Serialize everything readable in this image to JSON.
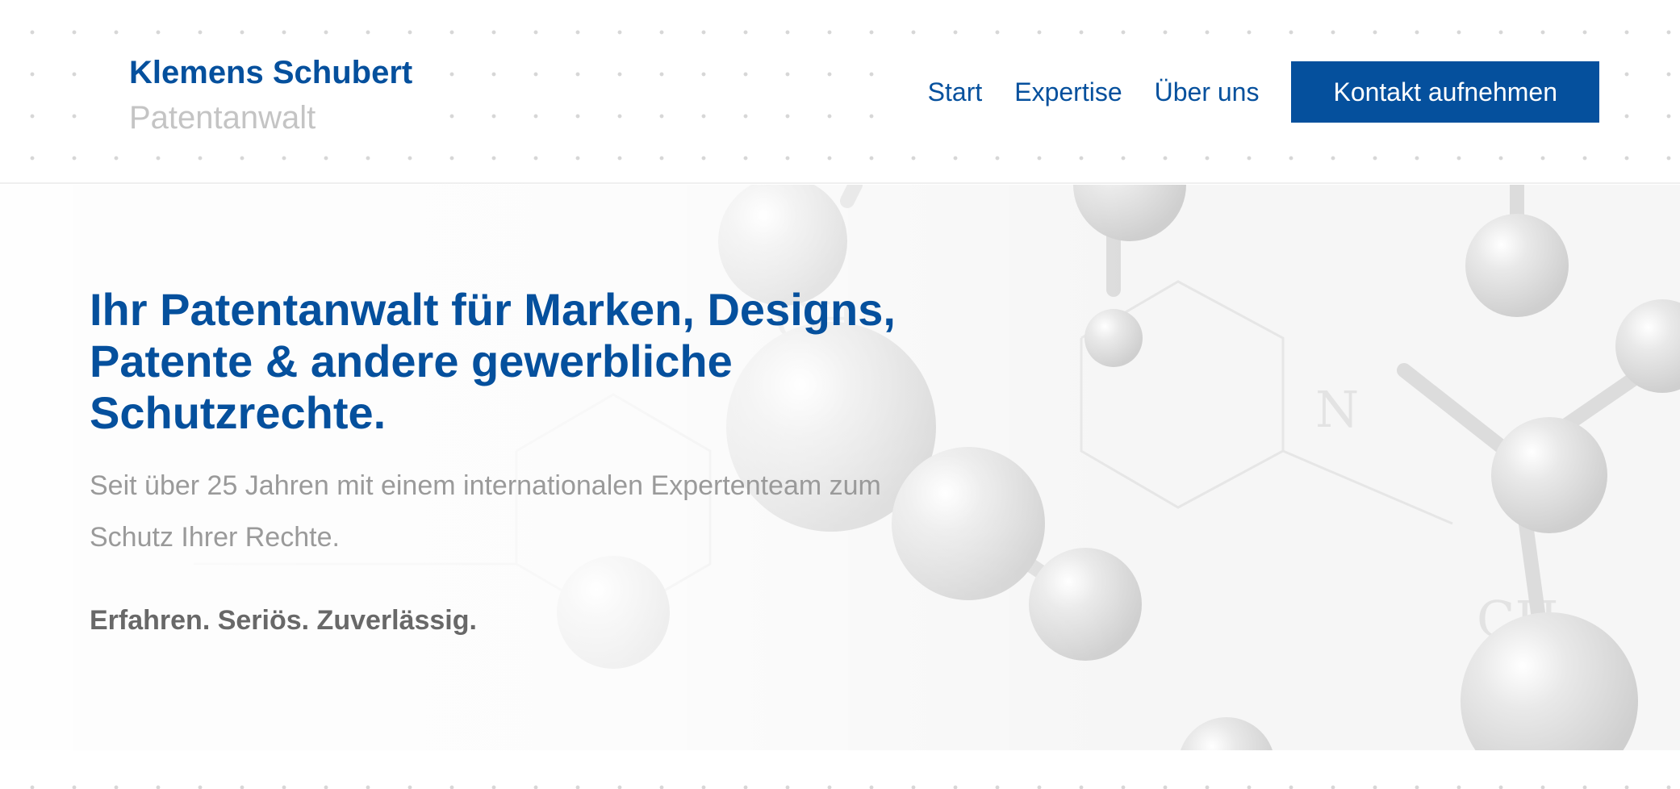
{
  "brand": {
    "name": "Klemens Schubert",
    "subtitle": "Patentanwalt"
  },
  "nav": {
    "items": [
      "Start",
      "Expertise",
      "Über uns"
    ],
    "cta_label": "Kontakt aufnehmen"
  },
  "hero": {
    "title": "Ihr Patentanwalt für Marken, Designs, Patente & andere gewerbliche Schutzrechte.",
    "subtitle": "Seit über 25 Jahren mit einem internationalen Expertenteam zum Schutz Ihrer Rechte.",
    "tagline": "Erfahren. Seriös. Zuverlässig.",
    "background_label_1": "CH",
    "background_label_2": "N"
  },
  "colors": {
    "primary": "#05509d",
    "muted_text": "#9a9a9a",
    "tagline_text": "#686868",
    "brand_subtitle": "#c4c4c4"
  }
}
